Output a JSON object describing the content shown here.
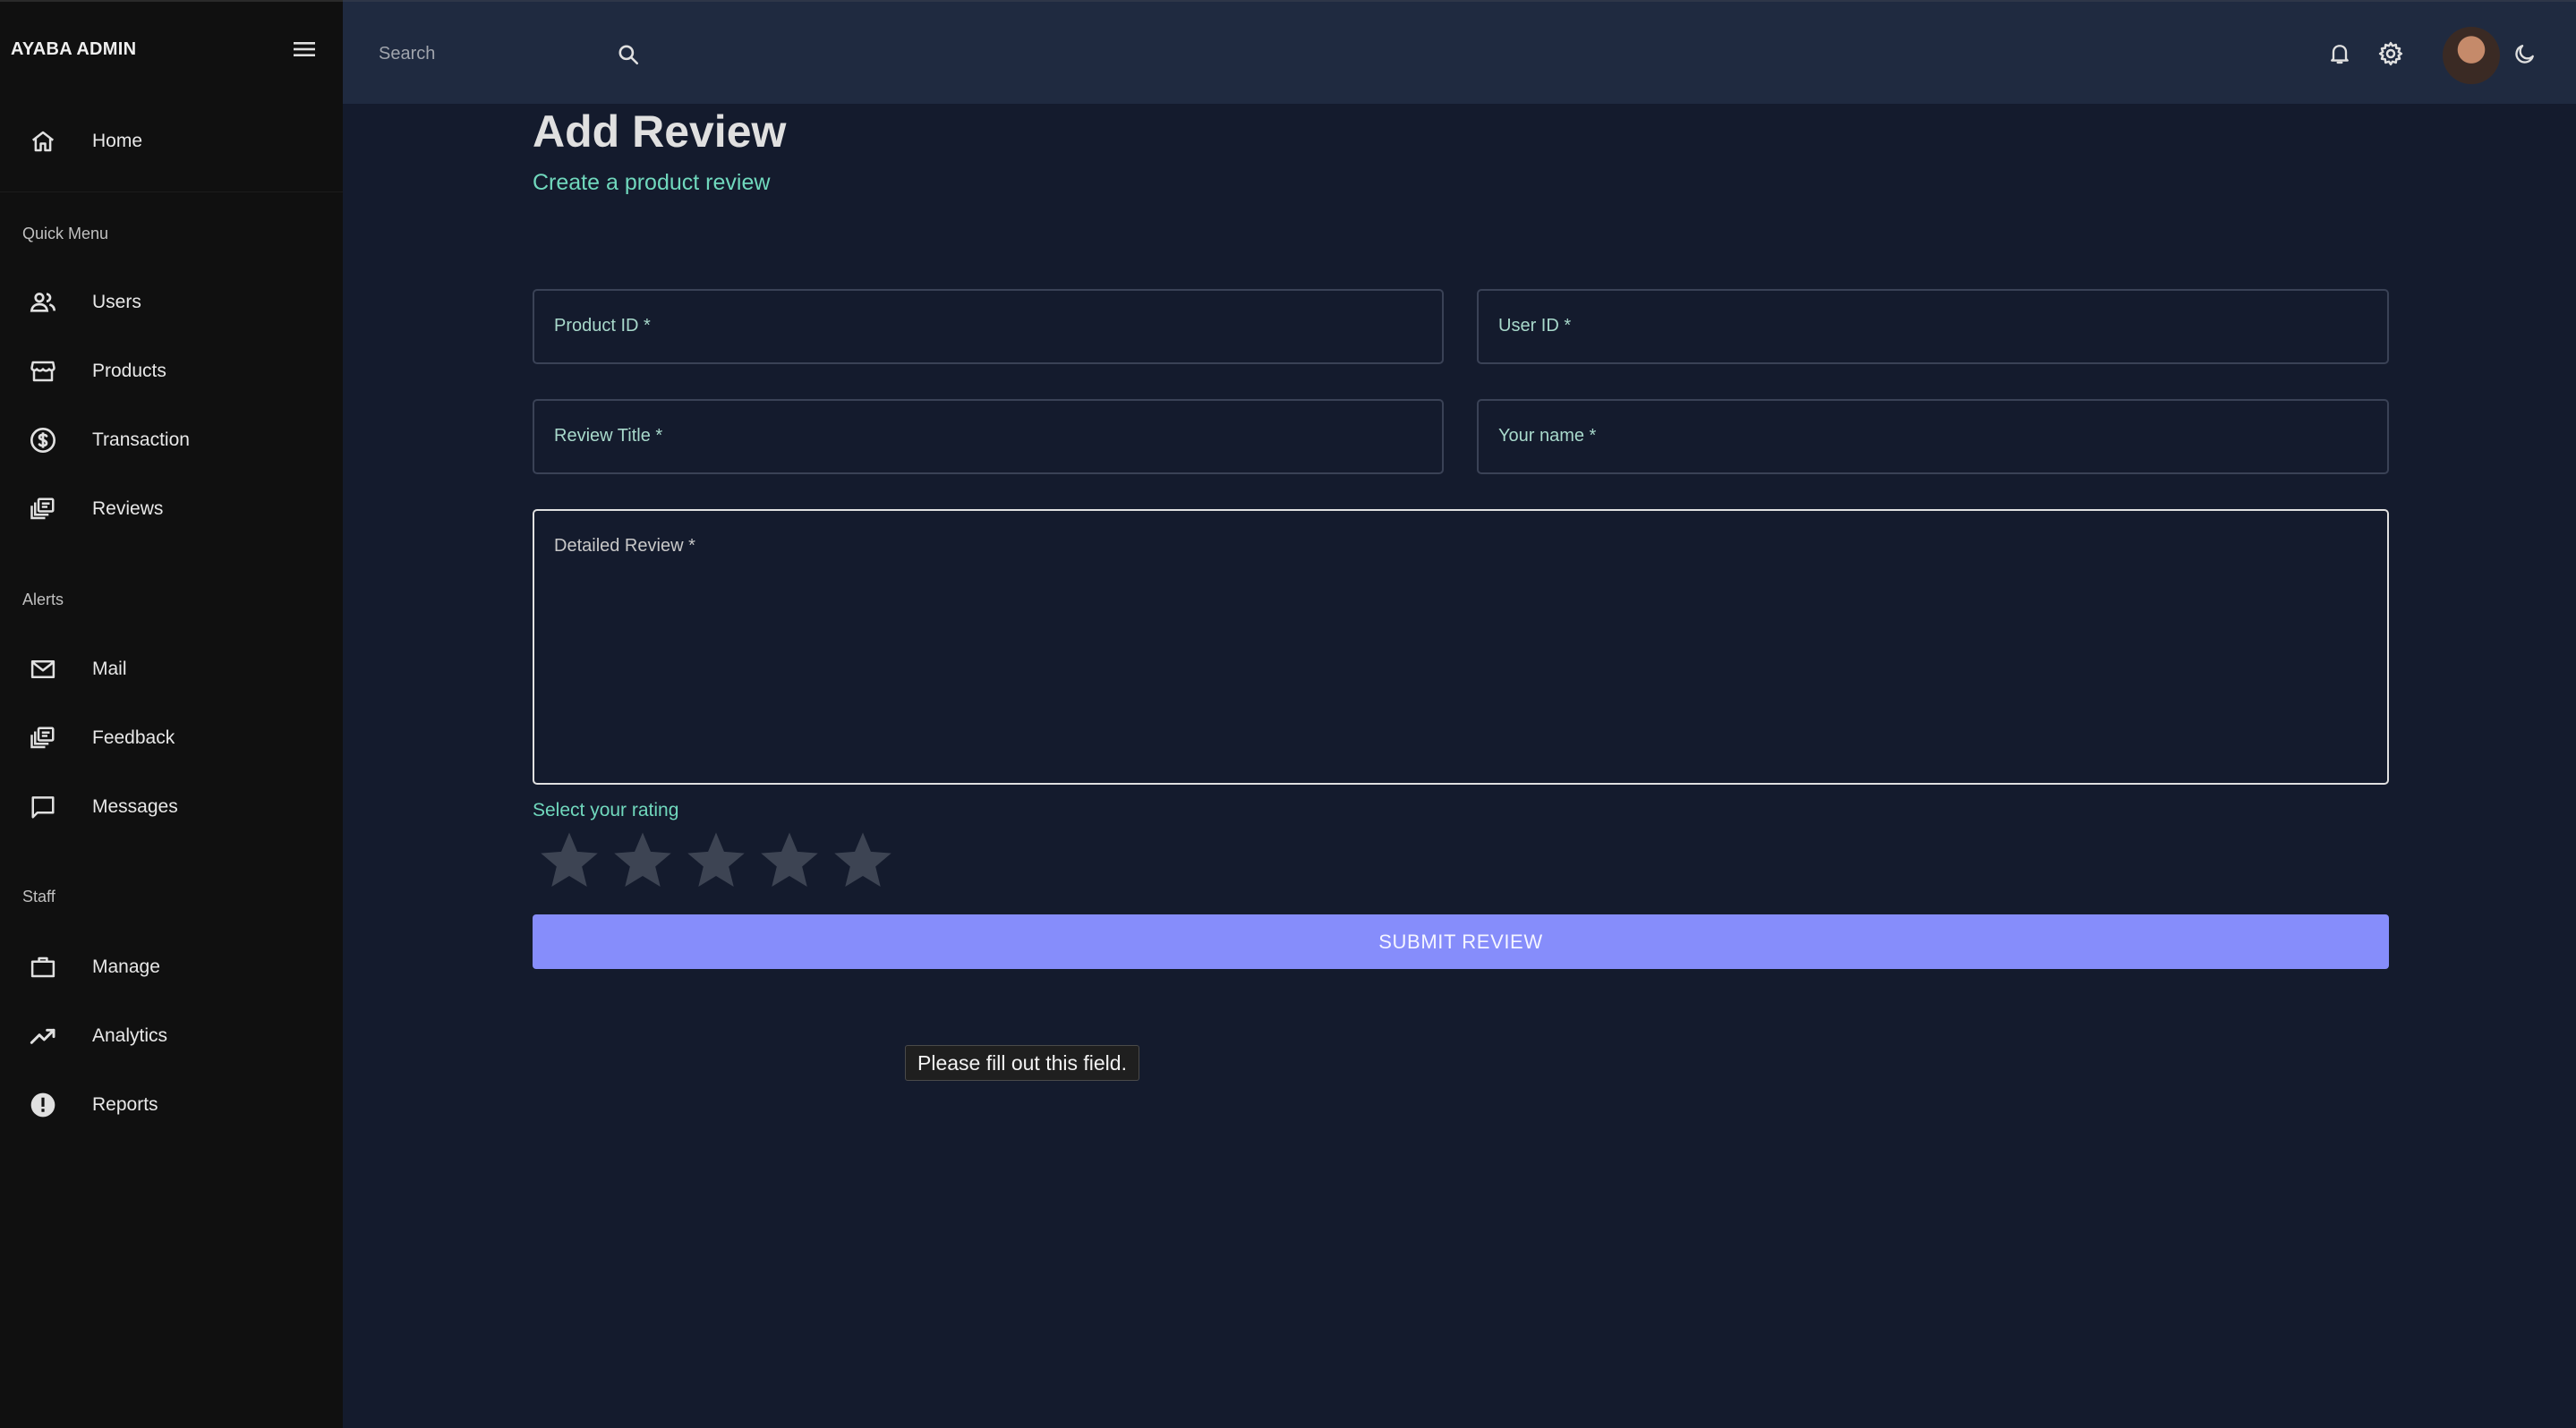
{
  "app": {
    "brand": "AYABA ADMIN"
  },
  "sidebar": {
    "home": {
      "label": "Home",
      "icon": "home-icon"
    },
    "sections": [
      {
        "title": "Quick Menu",
        "items": [
          {
            "label": "Users",
            "icon": "users-icon"
          },
          {
            "label": "Products",
            "icon": "storefront-icon"
          },
          {
            "label": "Transaction",
            "icon": "dollar-icon"
          },
          {
            "label": "Reviews",
            "icon": "reviews-icon"
          }
        ]
      },
      {
        "title": "Alerts",
        "items": [
          {
            "label": "Mail",
            "icon": "mail-icon"
          },
          {
            "label": "Feedback",
            "icon": "feedback-icon"
          },
          {
            "label": "Messages",
            "icon": "chat-icon"
          }
        ]
      },
      {
        "title": "Staff",
        "items": [
          {
            "label": "Manage",
            "icon": "briefcase-icon"
          },
          {
            "label": "Analytics",
            "icon": "trending-up-icon"
          },
          {
            "label": "Reports",
            "icon": "alert-circle-icon"
          }
        ]
      }
    ]
  },
  "topbar": {
    "search": {
      "placeholder": "Search",
      "value": ""
    }
  },
  "form": {
    "title": "Add Review",
    "subtitle": "Create a product review",
    "fields": {
      "product_id": {
        "label": "Product ID *"
      },
      "user_id": {
        "label": "User ID *"
      },
      "review_title": {
        "label": "Review Title *"
      },
      "your_name": {
        "label": "Your name *"
      },
      "detailed_review": {
        "label": "Detailed Review *"
      }
    },
    "rating_label": "Select your rating",
    "rating": {
      "value": 0,
      "max": 5
    },
    "submit_label": "SUBMIT REVIEW",
    "validation_tooltip": "Please fill out this field."
  },
  "colors": {
    "sidebar_bg": "#101010",
    "topbar_bg": "#1f2a40",
    "page_bg": "#141b2d",
    "accent_green": "#70d8bd",
    "button_bg": "#868dfb",
    "star_empty": "#3d4453"
  }
}
